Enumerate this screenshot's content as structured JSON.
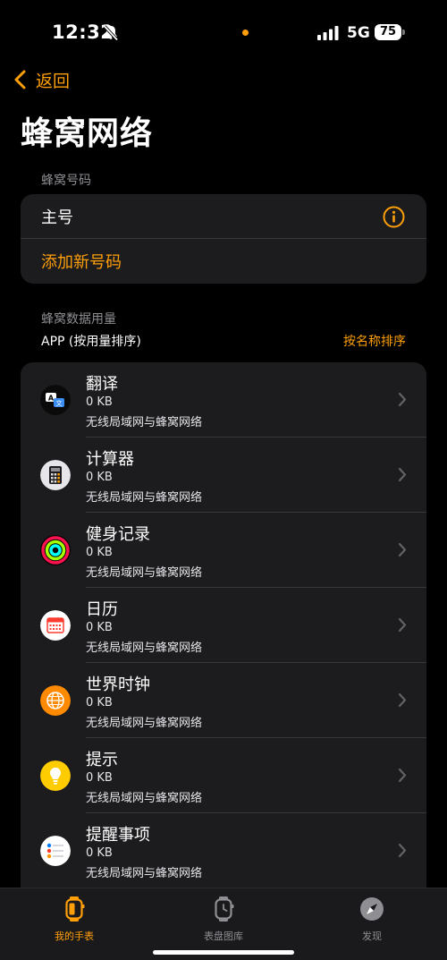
{
  "status": {
    "time": "12:32",
    "network": "5G",
    "battery": "75"
  },
  "nav": {
    "back_label": "返回",
    "title": "蜂窝网络"
  },
  "numbers": {
    "section_label": "蜂窝号码",
    "primary": "主号",
    "add_label": "添加新号码"
  },
  "usage": {
    "section_label": "蜂窝数据用量",
    "sort_info": "APP (按用量排序)",
    "sort_by_name": "按名称排序"
  },
  "apps": [
    {
      "name": "翻译",
      "size": "0 KB",
      "network": "无线局域网与蜂窝网络",
      "icon": "translate-icon"
    },
    {
      "name": "计算器",
      "size": "0 KB",
      "network": "无线局域网与蜂窝网络",
      "icon": "calculator-icon"
    },
    {
      "name": "健身记录",
      "size": "0 KB",
      "network": "无线局域网与蜂窝网络",
      "icon": "activity-rings-icon"
    },
    {
      "name": "日历",
      "size": "0 KB",
      "network": "无线局域网与蜂窝网络",
      "icon": "calendar-icon"
    },
    {
      "name": "世界时钟",
      "size": "0 KB",
      "network": "无线局域网与蜂窝网络",
      "icon": "globe-icon"
    },
    {
      "name": "提示",
      "size": "0 KB",
      "network": "无线局域网与蜂窝网络",
      "icon": "lightbulb-icon"
    },
    {
      "name": "提醒事项",
      "size": "0 KB",
      "network": "无线局域网与蜂窝网络",
      "icon": "reminders-icon"
    }
  ],
  "tabs": [
    {
      "label": "我的手表",
      "icon": "watch-icon",
      "active": true
    },
    {
      "label": "表盘图库",
      "icon": "watch-face-icon",
      "active": false
    },
    {
      "label": "发现",
      "icon": "compass-icon",
      "active": false
    }
  ],
  "colors": {
    "accent": "#ff9f0a",
    "card": "#1c1c1e",
    "background": "#000000",
    "secondary_text": "#8e8e93"
  }
}
